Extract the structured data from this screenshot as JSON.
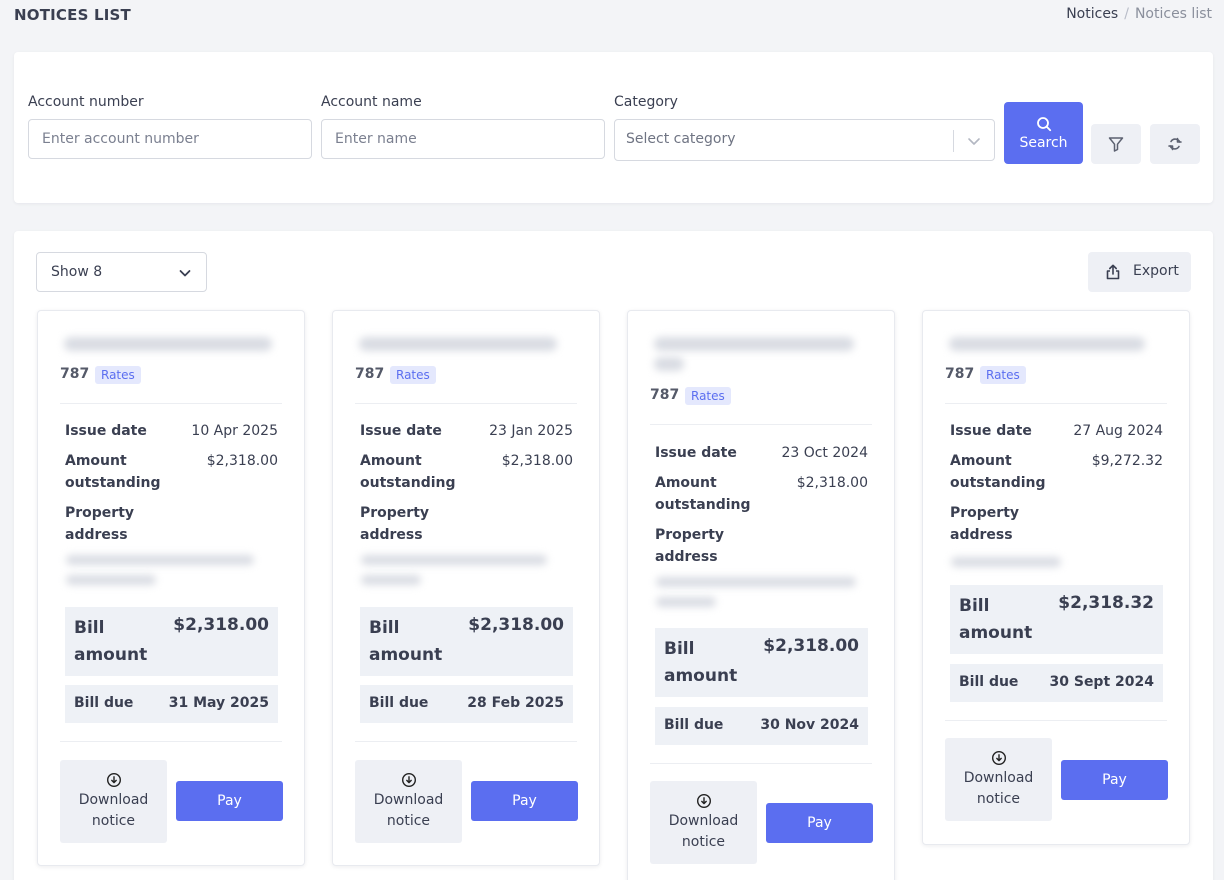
{
  "page": {
    "title": "NOTICES LIST",
    "breadcrumb": [
      "Notices",
      "Notices list"
    ]
  },
  "filters": {
    "account_number": {
      "label": "Account number",
      "placeholder": "Enter account number",
      "value": ""
    },
    "account_name": {
      "label": "Account name",
      "placeholder": "Enter name",
      "value": ""
    },
    "category": {
      "label": "Category",
      "placeholder": "Select category"
    },
    "search_label": "Search",
    "filter_icon": "filter-icon",
    "reset_icon": "refresh-icon"
  },
  "list": {
    "page_size_label": "Show 8",
    "export_label": "Export",
    "labels": {
      "issue_date": "Issue date",
      "amount_outstanding": "Amount outstanding",
      "property_address": "Property address",
      "bill_amount": "Bill amount",
      "bill_due": "Bill due",
      "download": "Download notice",
      "pay": "Pay"
    },
    "accent_color": "#5b6ef0",
    "notices": [
      {
        "account": "787",
        "category": "Rates",
        "issue_date": "10 Apr 2025",
        "amount_outstanding": "$2,318.00",
        "bill_amount": "$2,318.00",
        "bill_due": "31 May 2025"
      },
      {
        "account": "787",
        "category": "Rates",
        "issue_date": "23 Jan 2025",
        "amount_outstanding": "$2,318.00",
        "bill_amount": "$2,318.00",
        "bill_due": "28 Feb 2025"
      },
      {
        "account": "787",
        "category": "Rates",
        "issue_date": "23 Oct 2024",
        "amount_outstanding": "$2,318.00",
        "bill_amount": "$2,318.00",
        "bill_due": "30 Nov 2024"
      },
      {
        "account": "787",
        "category": "Rates",
        "issue_date": "27 Aug 2024",
        "amount_outstanding": "$9,272.32",
        "bill_amount": "$2,318.32",
        "bill_due": "30 Sept 2024"
      }
    ]
  }
}
